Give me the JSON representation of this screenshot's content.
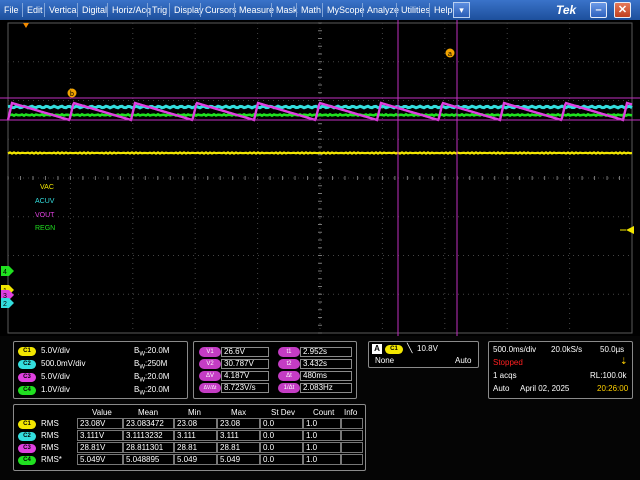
{
  "menubar": {
    "items": [
      "File",
      "Edit",
      "Vertical",
      "Digital",
      "Horiz/Acq",
      "Trig",
      "Display",
      "Cursors",
      "Measure",
      "Mask",
      "Math",
      "MyScope",
      "Analyze",
      "Utilities",
      "Help"
    ],
    "dropdown_glyph": "▾",
    "brand": "Tek",
    "minimize_glyph": "–",
    "close_glyph": "✕"
  },
  "waveform": {
    "markers": {
      "a": "a",
      "b": "b"
    },
    "labels": {
      "vac": "VAC",
      "acuv": "ACUV",
      "vout": "VOUT",
      "regn": "REGN"
    },
    "channel_markers": {
      "ch1": "1",
      "ch2": "2",
      "ch3": "3",
      "ch4": "4"
    },
    "colors": {
      "ch1": "#f2e600",
      "ch2": "#33dede",
      "ch3": "#e040e0",
      "ch4": "#20e020",
      "cursor": "#c030c0",
      "bg": "#000000"
    }
  },
  "channels": [
    {
      "id": "C1",
      "scale": "5.0V/div",
      "bw_label": "B",
      "bw_sub": "W",
      "bw_value": ":20.0M",
      "color": "#f2e600"
    },
    {
      "id": "C2",
      "scale": "500.0mV/div",
      "bw_label": "B",
      "bw_sub": "W",
      "bw_value": ":250M",
      "color": "#33dede"
    },
    {
      "id": "C3",
      "scale": "5.0V/div",
      "bw_label": "B",
      "bw_sub": "W",
      "bw_value": ":20.0M",
      "color": "#e040e0"
    },
    {
      "id": "C4",
      "scale": "1.0V/div",
      "bw_label": "B",
      "bw_sub": "W",
      "bw_value": ":20.0M",
      "color": "#20e020"
    }
  ],
  "cursors": {
    "left": [
      {
        "badge": "V1",
        "value": "26.6V"
      },
      {
        "badge": "V2",
        "value": "30.787V"
      },
      {
        "badge": "ΔV",
        "value": "4.187V"
      },
      {
        "badge": "ΔV/Δt",
        "value": "8.723V/s"
      }
    ],
    "right": [
      {
        "badge": "t1",
        "value": "2.952s"
      },
      {
        "badge": "t2",
        "value": "3.432s"
      },
      {
        "badge": "Δt",
        "value": "480ms"
      },
      {
        "badge": "1/Δt",
        "value": "2.083Hz"
      }
    ]
  },
  "trigger": {
    "badge": "A",
    "channel": "C1",
    "slope_glyph": "╲",
    "level": "10.8V",
    "coupling": "None",
    "mode": "Auto"
  },
  "acquisition": {
    "timebase": "500.0ms/div",
    "sample_rate": "20.0kS/s",
    "resolution": "50.0µs",
    "status": "Stopped",
    "acqs": "1 acqs",
    "record_length": "RL:100.0k",
    "mode": "Auto",
    "date": "April 02, 2025",
    "time": "20:26:00",
    "status_color": "#ff2020",
    "time_color": "#ffd000"
  },
  "measurements": {
    "headers": [
      "Value",
      "Mean",
      "Min",
      "Max",
      "St Dev",
      "Count",
      "Info"
    ],
    "rows": [
      {
        "ch": "C1",
        "type": "RMS",
        "value": "23.08V",
        "mean": "23.083472",
        "min": "23.08",
        "max": "23.08",
        "stdev": "0.0",
        "count": "1.0",
        "info": "",
        "color": "#f2e600"
      },
      {
        "ch": "C2",
        "type": "RMS",
        "value": "3.111V",
        "mean": "3.1113232",
        "min": "3.111",
        "max": "3.111",
        "stdev": "0.0",
        "count": "1.0",
        "info": "",
        "color": "#33dede"
      },
      {
        "ch": "C3",
        "type": "RMS",
        "value": "28.81V",
        "mean": "28.811301",
        "min": "28.81",
        "max": "28.81",
        "stdev": "0.0",
        "count": "1.0",
        "info": "",
        "color": "#e040e0"
      },
      {
        "ch": "C4",
        "type": "RMS*",
        "value": "5.049V",
        "mean": "5.048895",
        "min": "5.049",
        "max": "5.049",
        "stdev": "0.0",
        "count": "1.0",
        "info": "",
        "color": "#20e020"
      }
    ]
  }
}
